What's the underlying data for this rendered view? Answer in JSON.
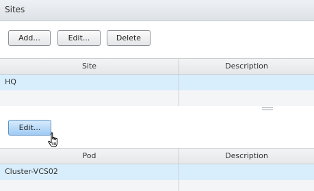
{
  "panel": {
    "title": "Sites"
  },
  "toolbar": {
    "add_label": "Add...",
    "edit_label": "Edit...",
    "delete_label": "Delete"
  },
  "sites_table": {
    "columns": [
      "Site",
      "Description"
    ],
    "rows": [
      {
        "site": "HQ",
        "description": ""
      }
    ]
  },
  "pods_toolbar": {
    "edit_label": "Edit..."
  },
  "pods_table": {
    "columns": [
      "Pod",
      "Description"
    ],
    "rows": [
      {
        "pod": "Cluster-VCS02",
        "description": ""
      }
    ]
  },
  "colors": {
    "selected_row": "#d9eefc",
    "hover_button": "#9fcaf4"
  },
  "icons": {
    "cursor": "hand-pointer-icon",
    "splitter": "splitter-grip-icon"
  }
}
